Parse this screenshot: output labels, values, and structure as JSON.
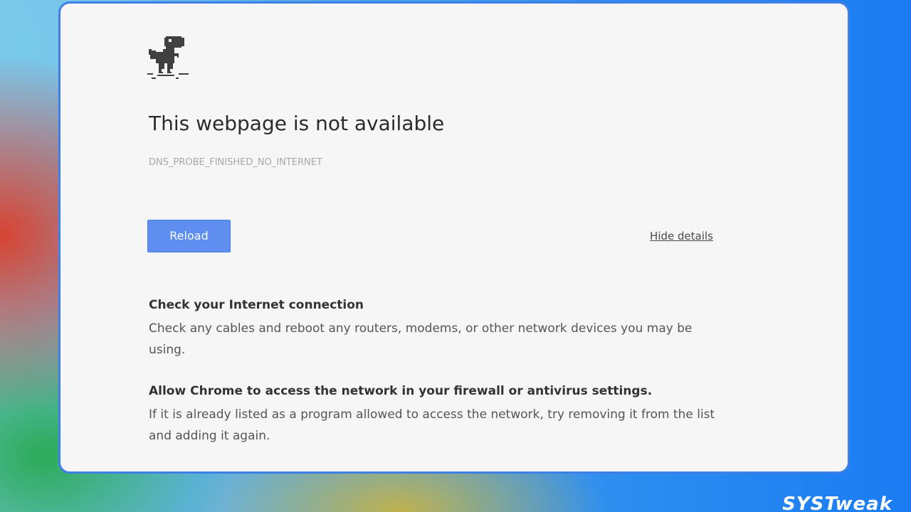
{
  "page": {
    "icon": "dino-icon",
    "title": "This webpage is not available",
    "error_code": "DNS_PROBE_FINISHED_NO_INTERNET",
    "reload_label": "Reload",
    "details_toggle_label": "Hide details"
  },
  "suggestions": [
    {
      "heading": "Check your Internet connection",
      "body": "Check any cables and reboot any routers, modems, or other network devices you may be using."
    },
    {
      "heading": "Allow Chrome to access the network in your firewall or antivirus settings.",
      "body": "If it is already listed as a program allowed to access the network, try removing it from the list and adding it again."
    }
  ],
  "watermark": "SYSTweak",
  "colors": {
    "accent": "#5d8ef0",
    "card_border": "#3f7fe6",
    "card_background": "#f6f6f6"
  }
}
